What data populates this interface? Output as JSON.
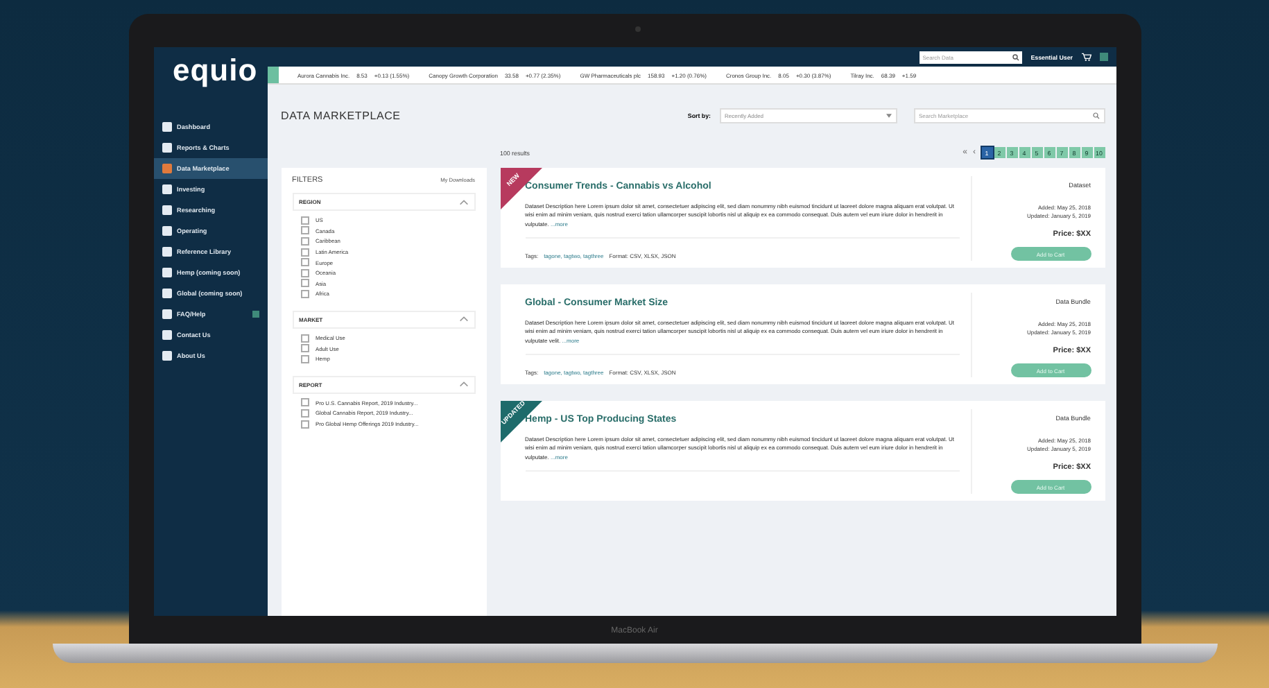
{
  "device": {
    "model": "MacBook Air"
  },
  "app": {
    "logo": "equio"
  },
  "topbar": {
    "search_placeholder": "Search Data",
    "user": "Essential User"
  },
  "ticker": [
    {
      "name": "Aurora Cannabis Inc.",
      "price": "8.53",
      "change": "+0.13 (1.55%)"
    },
    {
      "name": "Canopy Growth Corporation",
      "price": "33.58",
      "change": "+0.77 (2.35%)"
    },
    {
      "name": "GW Pharmaceuticals plc",
      "price": "158.93",
      "change": "+1.20 (0.76%)"
    },
    {
      "name": "Cronos Group Inc.",
      "price": "8.05",
      "change": "+0.30 (3.87%)"
    },
    {
      "name": "Tilray Inc.",
      "price": "68.39",
      "change": "+1.59"
    }
  ],
  "sidebar": {
    "items": [
      {
        "label": "Dashboard",
        "selected": false
      },
      {
        "label": "Reports & Charts",
        "selected": false
      },
      {
        "label": "Data Marketplace",
        "selected": true
      },
      {
        "label": "Investing",
        "selected": false
      },
      {
        "label": "Researching",
        "selected": false
      },
      {
        "label": "Operating",
        "selected": false
      },
      {
        "label": "Reference Library",
        "selected": false
      },
      {
        "label": "Hemp (coming soon)",
        "selected": false
      },
      {
        "label": "Global (coming soon)",
        "selected": false
      },
      {
        "label": "FAQ/Help",
        "selected": false,
        "badge": true
      },
      {
        "label": "Contact Us",
        "selected": false
      },
      {
        "label": "About Us",
        "selected": false
      }
    ]
  },
  "page": {
    "title": "DATA MARKETPLACE",
    "sort_label": "Sort by:",
    "sort_value": "Recently Added",
    "search_placeholder": "Search Marketplace",
    "results": "100 results"
  },
  "pagination": {
    "prev": [
      "«",
      "‹"
    ],
    "pages": [
      {
        "label": "1",
        "selected": true
      },
      {
        "label": "2",
        "selected": false
      },
      {
        "label": "3",
        "selected": false
      },
      {
        "label": "4",
        "selected": false
      },
      {
        "label": "5",
        "selected": false
      },
      {
        "label": "6",
        "selected": false
      },
      {
        "label": "7",
        "selected": false
      },
      {
        "label": "8",
        "selected": false
      },
      {
        "label": "9",
        "selected": false
      },
      {
        "label": "10",
        "selected": false
      }
    ]
  },
  "filters": {
    "title": "FILTERS",
    "link": "My Downloads",
    "groups": [
      {
        "title": "REGION",
        "expanded": true,
        "options": [
          {
            "label": "US",
            "checked": false
          },
          {
            "label": "Canada",
            "checked": false
          },
          {
            "label": "Caribbean",
            "checked": false
          },
          {
            "label": "Latin America",
            "checked": false
          },
          {
            "label": "Europe",
            "checked": false
          },
          {
            "label": "Oceania",
            "checked": false
          },
          {
            "label": "Asia",
            "checked": false
          },
          {
            "label": "Africa",
            "checked": false
          }
        ]
      },
      {
        "title": "MARKET",
        "expanded": true,
        "options": [
          {
            "label": "Medical Use",
            "checked": false
          },
          {
            "label": "Adult Use",
            "checked": false
          },
          {
            "label": "Hemp",
            "checked": false
          }
        ]
      },
      {
        "title": "REPORT",
        "expanded": true,
        "options": [
          {
            "label": "Pro U.S. Cannabis Report, 2019 Industry...",
            "checked": false
          },
          {
            "label": "Global Cannabis Report, 2019 Industry...",
            "checked": false
          },
          {
            "label": "Pro Global Hemp Offerings 2019 Industry...",
            "checked": false
          }
        ]
      }
    ]
  },
  "datasets": [
    {
      "ribbon": "NEW",
      "color": "#b73a5e",
      "title": "Consumer Trends - Cannabis vs Alcohol",
      "type": "Dataset",
      "description": "Dataset Description here Lorem ipsum dolor sit amet, consectetuer adipiscing elit, sed diam nonummy nibh euismod tincidunt ut laoreet dolore magna aliquam erat volutpat. Ut wisi enim ad minim veniam, quis nostrud exerci tation ullamcorper suscipit lobortis nisl ut aliquip ex ea commodo consequat. Duis autem vel eum iriure dolor in hendrerit in vulputate.",
      "more": "...more",
      "tags_label": "Tags:",
      "tags": "tagone, tagtwo, tagthree",
      "format": "Format: CSV, XLSX, JSON",
      "added": "Added: May 25, 2018",
      "updated": "Updated: January 5, 2019",
      "price": "Price: $XX",
      "button": "Add to Cart"
    },
    {
      "title": "Global - Consumer Market Size",
      "type": "Data Bundle",
      "description": "Dataset Description here Lorem ipsum dolor sit amet, consectetuer adipiscing elit, sed diam nonummy nibh euismod tincidunt ut laoreet dolore magna aliquam erat volutpat. Ut wisi enim ad minim veniam, quis nostrud exerci tation ullamcorper suscipit lobortis nisl ut aliquip ex ea commodo consequat. Duis autem vel eum iriure dolor in hendrerit in vulputate velit.",
      "more": "...more",
      "tags_label": "Tags:",
      "tags": "tagone, tagtwo, tagthree",
      "format": "Format: CSV, XLSX, JSON",
      "added": "Added: May 25, 2018",
      "updated": "Updated: January 5, 2019",
      "price": "Price: $XX",
      "button": "Add to Cart"
    },
    {
      "ribbon": "UPDATED",
      "color": "#1e6b6b",
      "title": "Hemp - US Top Producing States",
      "type": "Data Bundle",
      "description": "Dataset Description here Lorem ipsum dolor sit amet, consectetuer adipiscing elit, sed diam nonummy nibh euismod tincidunt ut laoreet dolore magna aliquam erat volutpat. Ut wisi enim ad minim veniam, quis nostrud exerci tation ullamcorper suscipit lobortis nisl ut aliquip ex ea commodo consequat. Duis autem vel eum iriure dolor in hendrerit in vulputate.",
      "more": "...more",
      "added": "Added: May 25, 2018",
      "updated": "Updated: January 5, 2019",
      "price": "Price: $XX",
      "button": "Add to Cart"
    }
  ]
}
